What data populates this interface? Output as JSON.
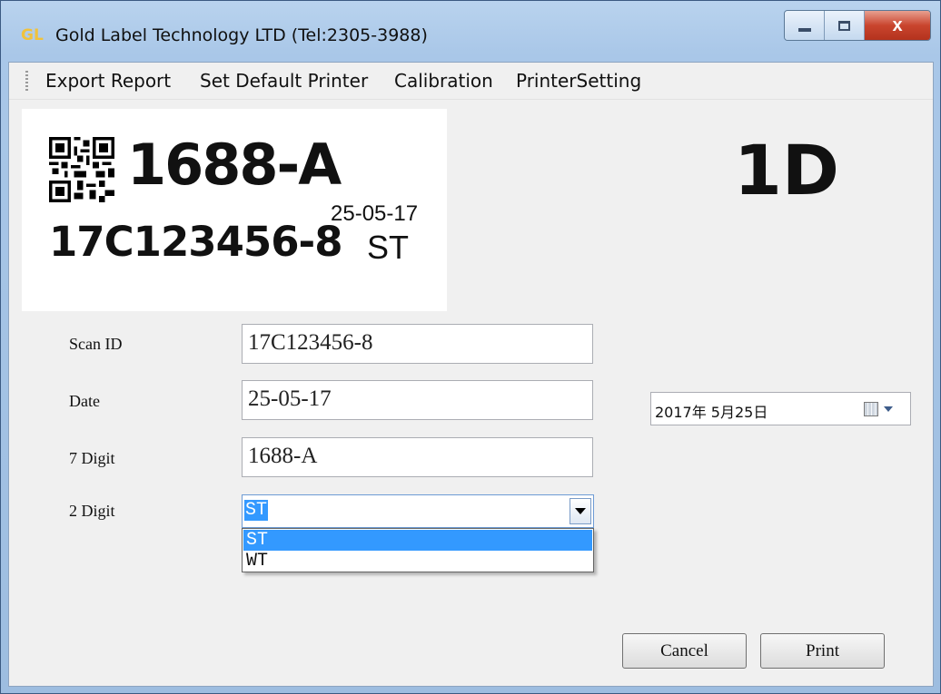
{
  "window": {
    "app_icon": "GL",
    "title": "Gold Label Technology LTD (Tel:2305-3988)",
    "controls": {
      "minimize": "minimize-icon",
      "maximize": "maximize-icon",
      "close": "x"
    }
  },
  "menu": {
    "items": [
      "Export Report",
      "Set Default Printer",
      "Calibration",
      "PrinterSetting"
    ]
  },
  "label_preview": {
    "code_7digit": "1688-A",
    "scan_id": "17C123456-8",
    "date": "25-05-17",
    "code_2digit": "ST"
  },
  "badge": "1D",
  "form": {
    "scan_id": {
      "label": "Scan ID",
      "value": "17C123456-8"
    },
    "date": {
      "label": "Date",
      "value": "25-05-17"
    },
    "seven_digit": {
      "label": "7 Digit",
      "value": "1688-A"
    },
    "two_digit": {
      "label": "2 Digit",
      "value": "ST",
      "options": [
        "ST",
        "WT"
      ]
    }
  },
  "datepicker": {
    "value": "2017年  5月25日"
  },
  "buttons": {
    "cancel": "Cancel",
    "print": "Print"
  },
  "colors": {
    "selection": "#3399ff",
    "title_bar": "#a9c7e8",
    "close_button": "#c9452e"
  }
}
